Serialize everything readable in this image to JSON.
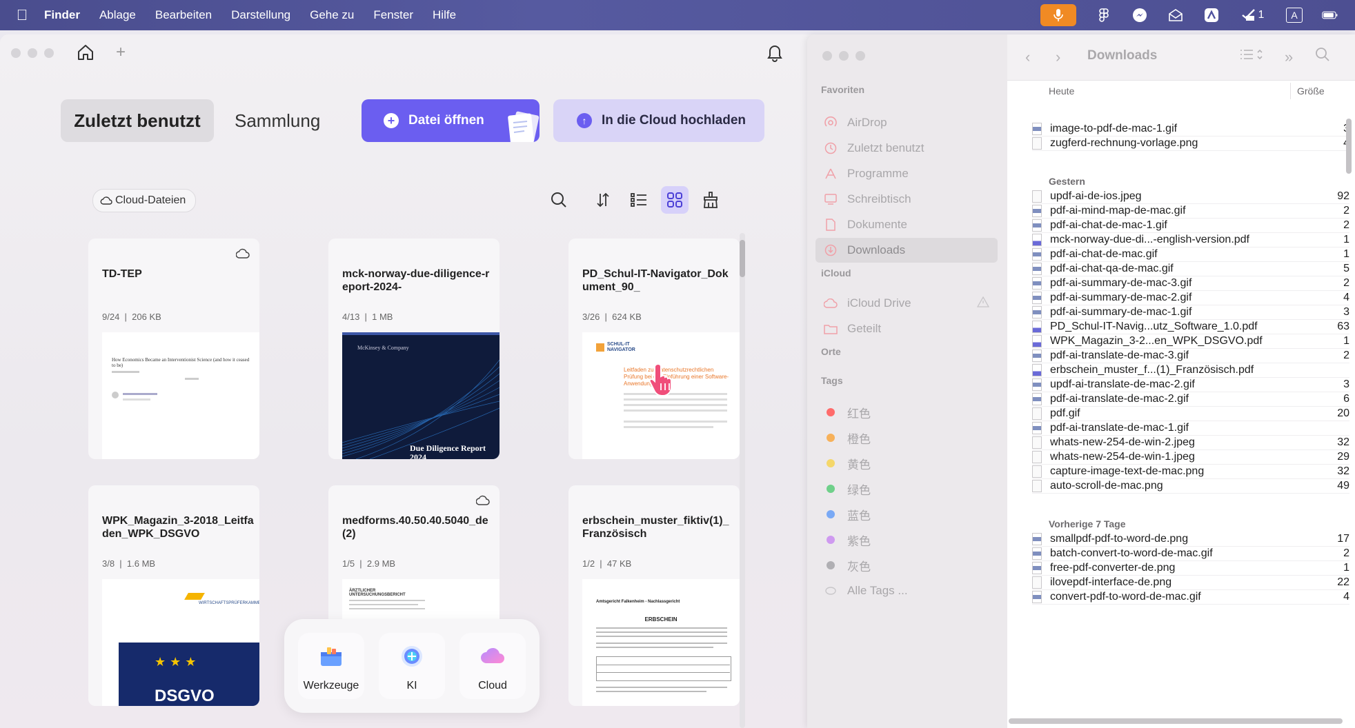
{
  "menubar": {
    "app": "Finder",
    "items": [
      "Ablage",
      "Bearbeiten",
      "Darstellung",
      "Gehe zu",
      "Fenster",
      "Hilfe"
    ],
    "status_badge": "1",
    "input_source": "A"
  },
  "updf": {
    "tabs": {
      "recent": "Zuletzt benutzt",
      "collection": "Sammlung"
    },
    "open_button": "Datei öffnen",
    "cloud_button": "In die Cloud hochladen",
    "cloud_files_chip": "Cloud-Dateien",
    "files": [
      {
        "title": "TD-TEP",
        "date": "9/24",
        "size": "206 KB",
        "cloud": true,
        "thumb_text": "How Economics Became an Interventionist Science (and how it ceased to be)"
      },
      {
        "title": "mck-norway-due-diligence-report-2024-",
        "date": "4/13",
        "size": "1 MB",
        "cloud": false,
        "thumb_brand": "McKinsey & Company",
        "thumb_text": "Due Diligence Report 2024"
      },
      {
        "title": "PD_Schul-IT-Navigator_Dokument_90_",
        "date": "3/26",
        "size": "624 KB",
        "cloud": false,
        "thumb_brand": "SCHUL-IT NAVIGATOR",
        "thumb_text": "Leitfaden zur datenschutzrechtlichen Prüfung bei der Einführung einer Software-Anwendung"
      },
      {
        "title": "WPK_Magazin_3-2018_Leitfaden_WPK_DSGVO",
        "date": "3/8",
        "size": "1.6 MB",
        "cloud": false,
        "thumb_brand": "WIRTSCHAFTSPRÜFERKAMMER",
        "thumb_text": "DSGVO"
      },
      {
        "title": "medforms.40.50.40.5040_de(2)",
        "date": "1/5",
        "size": "2.9 MB",
        "cloud": true,
        "thumb_text": "ÄRZTLICHER UNTERSUCHUNGSBERICHT"
      },
      {
        "title": "erbschein_muster_fiktiv(1)_Französisch",
        "date": "1/2",
        "size": "47 KB",
        "cloud": false,
        "thumb_brand": "Amtsgericht Falkenheim - Nachlassgericht",
        "thumb_text": "ERBSCHEIN"
      }
    ],
    "dock": [
      "Werkzeuge",
      "KI",
      "Cloud"
    ]
  },
  "finder": {
    "title": "Downloads",
    "sidebar": {
      "favorites_header": "Favoriten",
      "favorites": [
        "AirDrop",
        "Zuletzt benutzt",
        "Programme",
        "Schreibtisch",
        "Dokumente",
        "Downloads"
      ],
      "icloud_header": "iCloud",
      "icloud": [
        "iCloud Drive",
        "Geteilt"
      ],
      "places_header": "Orte",
      "tags_header": "Tags",
      "tags": [
        {
          "name": "红色",
          "color": "#ff5f57"
        },
        {
          "name": "橙色",
          "color": "#ff9f0a"
        },
        {
          "name": "黄色",
          "color": "#ffd60a"
        },
        {
          "name": "绿色",
          "color": "#32d74b"
        },
        {
          "name": "蓝色",
          "color": "#0a84ff"
        },
        {
          "name": "紫色",
          "color": "#bf5af2"
        },
        {
          "name": "灰色",
          "color": "#98989d"
        }
      ],
      "all_tags": "Alle Tags ..."
    },
    "columns": {
      "name": "Heute",
      "size": "Größe"
    },
    "groups": [
      {
        "label": "",
        "files": [
          {
            "name": "image-to-pdf-de-mac-1.gif",
            "size": "3",
            "type": "img"
          },
          {
            "name": "zugferd-rechnung-vorlage.png",
            "size": "4",
            "type": "doc"
          }
        ]
      },
      {
        "label": "Gestern",
        "files": [
          {
            "name": "updf-ai-de-ios.jpeg",
            "size": "92",
            "type": "doc"
          },
          {
            "name": "pdf-ai-mind-map-de-mac.gif",
            "size": "2",
            "type": "img"
          },
          {
            "name": "pdf-ai-chat-de-mac-1.gif",
            "size": "2",
            "type": "img"
          },
          {
            "name": "mck-norway-due-di...-english-version.pdf",
            "size": "1",
            "type": "pdf"
          },
          {
            "name": "pdf-ai-chat-de-mac.gif",
            "size": "1",
            "type": "img"
          },
          {
            "name": "pdf-ai-chat-qa-de-mac.gif",
            "size": "5",
            "type": "img"
          },
          {
            "name": "pdf-ai-summary-de-mac-3.gif",
            "size": "2",
            "type": "img"
          },
          {
            "name": "pdf-ai-summary-de-mac-2.gif",
            "size": "4",
            "type": "img"
          },
          {
            "name": "pdf-ai-summary-de-mac-1.gif",
            "size": "3",
            "type": "img"
          },
          {
            "name": "PD_Schul-IT-Navig...utz_Software_1.0.pdf",
            "size": "63",
            "type": "pdf"
          },
          {
            "name": "WPK_Magazin_3-2...en_WPK_DSGVO.pdf",
            "size": "1",
            "type": "pdf"
          },
          {
            "name": "pdf-ai-translate-de-mac-3.gif",
            "size": "2",
            "type": "img"
          },
          {
            "name": "erbschein_muster_f...(1)_Französisch.pdf",
            "size": "",
            "type": "pdf"
          },
          {
            "name": "updf-ai-translate-de-mac-2.gif",
            "size": "3",
            "type": "img"
          },
          {
            "name": "pdf-ai-translate-de-mac-2.gif",
            "size": "6",
            "type": "img"
          },
          {
            "name": "pdf.gif",
            "size": "20",
            "type": "doc"
          },
          {
            "name": "pdf-ai-translate-de-mac-1.gif",
            "size": "",
            "type": "img"
          },
          {
            "name": "whats-new-254-de-win-2.jpeg",
            "size": "32",
            "type": "doc"
          },
          {
            "name": "whats-new-254-de-win-1.jpeg",
            "size": "29",
            "type": "doc"
          },
          {
            "name": "capture-image-text-de-mac.png",
            "size": "32",
            "type": "doc"
          },
          {
            "name": "auto-scroll-de-mac.png",
            "size": "49",
            "type": "doc"
          }
        ]
      },
      {
        "label": "Vorherige 7 Tage",
        "files": [
          {
            "name": "smallpdf-pdf-to-word-de.png",
            "size": "17",
            "type": "img"
          },
          {
            "name": "batch-convert-to-word-de-mac.gif",
            "size": "2",
            "type": "img"
          },
          {
            "name": "free-pdf-converter-de.png",
            "size": "1",
            "type": "img"
          },
          {
            "name": "ilovepdf-interface-de.png",
            "size": "22",
            "type": "doc"
          },
          {
            "name": "convert-pdf-to-word-de-mac.gif",
            "size": "4",
            "type": "img"
          }
        ]
      }
    ]
  }
}
